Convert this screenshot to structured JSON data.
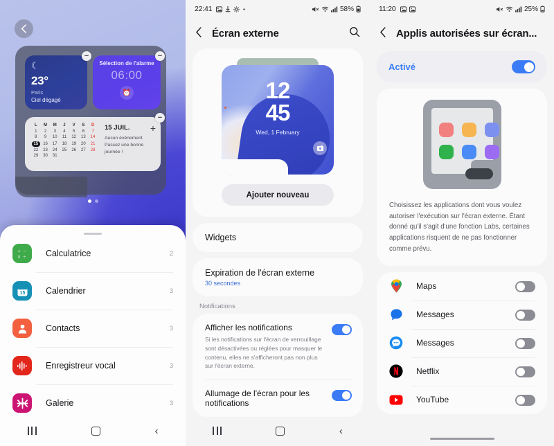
{
  "panel1": {
    "back_icon": "chevron-left-icon",
    "weather_widget": {
      "icon": "moon-icon",
      "temperature": "23°",
      "city": "Paris",
      "condition": "Ciel dégagé",
      "remove_icon": "minus-icon"
    },
    "alarm_widget": {
      "title": "Sélection de l'alarme",
      "time": "06:00",
      "icon": "alarm-clock-icon",
      "remove_icon": "minus-icon"
    },
    "calendar_widget": {
      "weekday_headers": [
        "L",
        "M",
        "M",
        "J",
        "V",
        "S",
        "D"
      ],
      "weeks": [
        [
          "1",
          "2",
          "3",
          "4",
          "5",
          "6",
          "7"
        ],
        [
          "8",
          "9",
          "10",
          "11",
          "12",
          "13",
          "14"
        ],
        [
          "15",
          "16",
          "17",
          "18",
          "19",
          "20",
          "21"
        ],
        [
          "22",
          "23",
          "24",
          "25",
          "26",
          "27",
          "28"
        ],
        [
          "29",
          "30",
          "31",
          "",
          "",
          "",
          ""
        ]
      ],
      "today": "15",
      "date_title": "15 JUIL.",
      "note_line1": "Aucun événement",
      "note_line2": "Passez une bonne",
      "note_line3": "journée !",
      "add_icon": "plus-icon",
      "remove_icon": "minus-icon"
    },
    "pager": {
      "total": 2,
      "active": 1
    },
    "sheet": {
      "grabber": "drag-handle",
      "apps": [
        {
          "name": "Calculatrice",
          "count": "2",
          "icon": "calculator-icon",
          "color": "#3faa49",
          "glyph": "+−\n×÷"
        },
        {
          "name": "Calendrier",
          "count": "3",
          "icon": "calendar-icon",
          "color": "#1690b5",
          "glyph": "15"
        },
        {
          "name": "Contacts",
          "count": "3",
          "icon": "contacts-icon",
          "color": "#f2603f",
          "glyph": "person"
        },
        {
          "name": "Enregistreur vocal",
          "count": "3",
          "icon": "voice-recorder-icon",
          "color": "#e2261c",
          "glyph": "waveform"
        },
        {
          "name": "Galerie",
          "count": "3",
          "icon": "gallery-icon",
          "color": "#cc1473",
          "glyph": "flower"
        }
      ]
    },
    "navbar": {
      "recents": "recents-icon",
      "home": "home-icon",
      "back": "back-icon"
    }
  },
  "panel2": {
    "status_bar": {
      "time": "22:41",
      "left_icons": [
        "image-icon",
        "download-icon",
        "gear-icon",
        "dot-icon"
      ],
      "right_icons": [
        "mute-icon",
        "wifi-icon",
        "signal-icon"
      ],
      "battery": "58%"
    },
    "header": {
      "back_icon": "chevron-left-icon",
      "title": "Écran externe",
      "search_icon": "search-icon"
    },
    "preview": {
      "clock_hours": "12",
      "clock_minutes": "45",
      "date": "Wed, 1 February",
      "edit_icon": "edit-cover-icon",
      "add_button": "Ajouter nouveau"
    },
    "widgets_row": {
      "label": "Widgets"
    },
    "timeout_row": {
      "label": "Expiration de l'écran externe",
      "value": "30 secondes"
    },
    "notifications_section": "Notifications",
    "toggles": [
      {
        "title": "Afficher les notifications",
        "subtitle": "Si les notifications sur l'écran de verrouillage sont désactivées ou réglées pour masquer le contenu, elles ne s'afficheront pas non plus sur l'écran externe.",
        "state": "on"
      },
      {
        "title": "Allumage de l'écran pour les notifications",
        "subtitle": "",
        "state": "on"
      }
    ],
    "navbar": {
      "recents": "recents-icon",
      "home": "home-icon",
      "back": "back-icon"
    }
  },
  "panel3": {
    "status_bar": {
      "time": "11:20",
      "left_icons": [
        "image-icon",
        "image-icon"
      ],
      "right_icons": [
        "mute-icon",
        "wifi-icon",
        "signal-icon"
      ],
      "battery": "25%"
    },
    "header": {
      "back_icon": "chevron-left-icon",
      "title": "Applis autorisées sur écran..."
    },
    "master_toggle": {
      "label": "Activé",
      "state": "on"
    },
    "illustration": {
      "name": "tablet-apps-illustration",
      "dot_colors": [
        "#f2807f",
        "#f6b košt"
      ],
      "colors": [
        "#f2807f",
        "#f5b council",
        "#7c90f0",
        "#2fb24c",
        "#4b8bf5",
        "#9b6cf2"
      ]
    },
    "description": "Choisissez les applications dont vous voulez autoriser l'exécution sur l'écran externe. Étant donné qu'il s'agit d'une fonction Labs, certaines applications risquent de ne pas fonctionner comme prévu.",
    "apps": [
      {
        "name": "Maps",
        "icon": "google-maps-icon",
        "state": "off"
      },
      {
        "name": "Messages",
        "icon": "google-messages-icon",
        "state": "off"
      },
      {
        "name": "Messages",
        "icon": "samsung-messages-icon",
        "state": "off"
      },
      {
        "name": "Netflix",
        "icon": "netflix-icon",
        "state": "off"
      },
      {
        "name": "YouTube",
        "icon": "youtube-icon",
        "state": "off"
      }
    ],
    "gesture_bar": "gesture-handle"
  }
}
